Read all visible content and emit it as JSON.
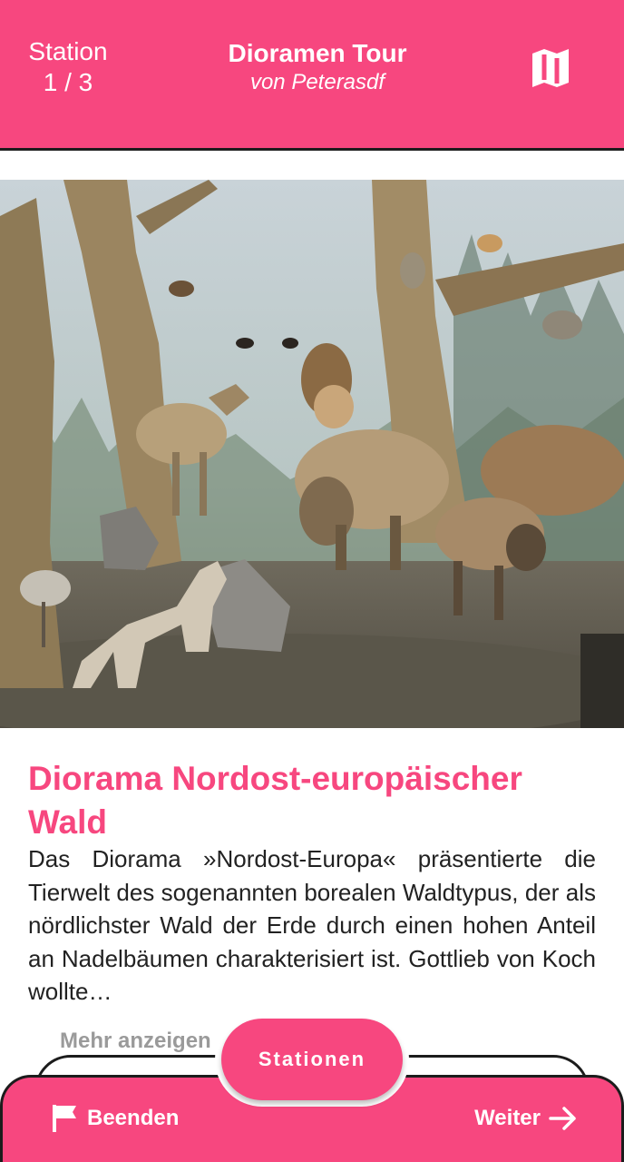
{
  "header": {
    "station_label": "Station",
    "station_count": "1 / 3",
    "tour_title": "Dioramen Tour",
    "tour_author": "von Peterasdf",
    "map_icon": "map-icon"
  },
  "station": {
    "title": "Diorama Nordost-europäischer Wald",
    "description": "Das Diorama »Nordost-Europa« präsentierte die Tierwelt des sogenannten borealen Waldtypus, der als nördlichster Wald der Erde durch einen hohen Anteil an Nadelbäumen charakterisiert ist. Gottlieb von Koch wollte…",
    "more_label": "Mehr anzeigen"
  },
  "bottom_bar": {
    "end_label": "Beenden",
    "end_icon": "flag-icon",
    "next_label": "Weiter",
    "next_icon": "arrow-right-icon",
    "stations_label": "Stationen"
  },
  "colors": {
    "accent": "#f7477f",
    "text": "#222222",
    "muted": "#9a9a9a"
  }
}
